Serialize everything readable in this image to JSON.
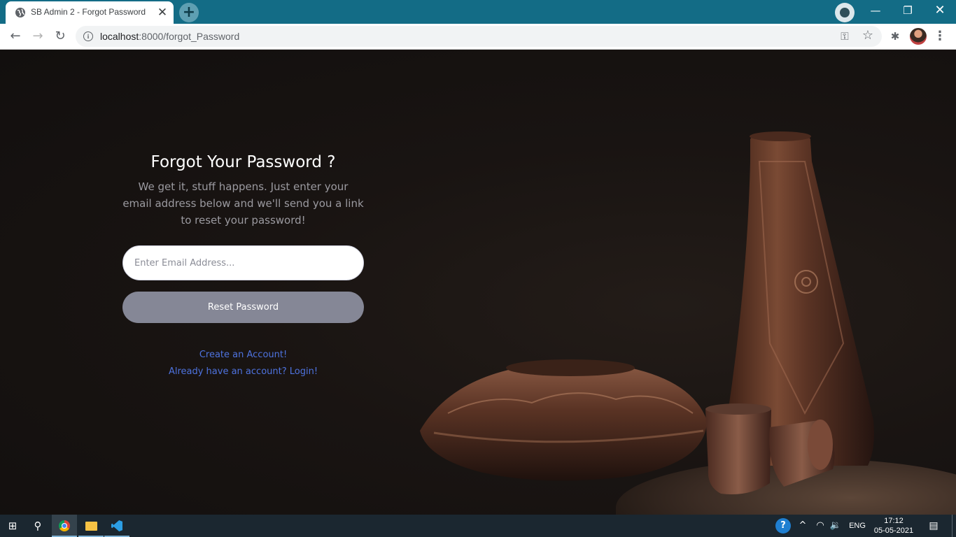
{
  "browser": {
    "tab": {
      "title": "SB Admin 2 - Forgot Password",
      "close_glyph": "✕",
      "favicon": "globe-icon"
    },
    "new_tab_glyph": "+",
    "window_controls": {
      "minimize": "—",
      "restore": "❐",
      "close": "✕"
    },
    "nav": {
      "back": "←",
      "forward": "→",
      "reload": "↻"
    },
    "url": {
      "host": "localhost",
      "port_path": ":8000/forgot_Password"
    },
    "icons": {
      "info": "i",
      "key": "⚿",
      "star": "☆",
      "extensions": "✱",
      "menu": "⋮"
    }
  },
  "page": {
    "title": "Forgot Your Password ?",
    "subtitle": "We get it, stuff happens. Just enter your email address below and we'll send you a link to reset your password!",
    "email_placeholder": "Enter Email Address...",
    "reset_button": "Reset Password",
    "create_account_link": "Create an Account!",
    "login_link": "Already have an account? Login!",
    "colors": {
      "link": "#4e73df",
      "button": "#858796",
      "title": "#ffffff"
    }
  },
  "taskbar": {
    "start_glyph": "⊞",
    "search_glyph": "⚲",
    "tray": {
      "help": "?",
      "chevron": "^",
      "wifi": "◠",
      "volume": "🔉",
      "language": "ENG"
    },
    "clock": {
      "time": "17:12",
      "date": "05-05-2021"
    },
    "notifications_glyph": "▤"
  }
}
